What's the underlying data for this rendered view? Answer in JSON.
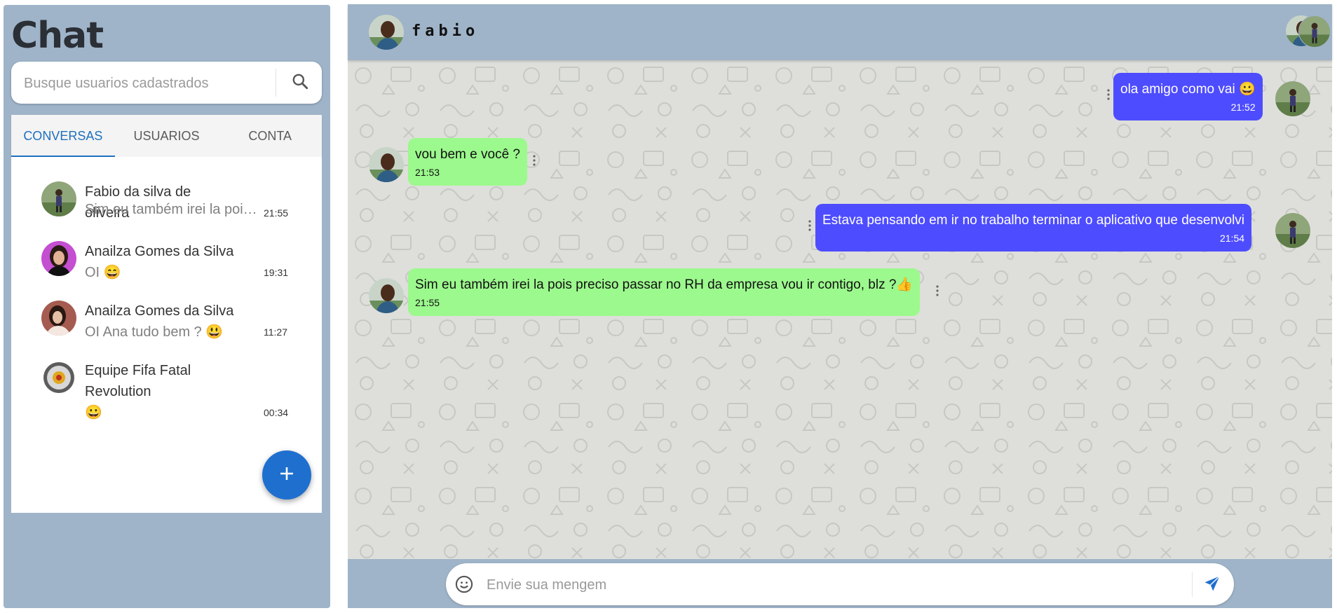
{
  "sidebar": {
    "title": "Chat",
    "search": {
      "placeholder": "Busque usuarios cadastrados",
      "icon": "search-icon"
    },
    "tabs": [
      {
        "label": "CONVERSAS",
        "active": true
      },
      {
        "label": "USUARIOS",
        "active": false
      },
      {
        "label": "CONTA",
        "active": false
      }
    ],
    "conversations": [
      {
        "name": "Fabio da silva de oliveira",
        "preview": "Sim eu também irei la pois preciso passar no RH da empresa vou ir contigo, blz ?👍",
        "time": "21:55",
        "avatar": "fabio-photo"
      },
      {
        "name": "Anailza Gomes da Silva",
        "preview": "OI 😄",
        "time": "19:31",
        "avatar": "anailza-photo-1"
      },
      {
        "name": "Anailza Gomes da Silva",
        "preview": "OI Ana tudo bem ? 😃",
        "time": "11:27",
        "avatar": "anailza-photo-2"
      },
      {
        "name": "Equipe Fifa Fatal Revolution",
        "preview": "😀",
        "time": "00:34",
        "avatar": "fifa-logo"
      }
    ],
    "fab_icon": "plus-icon"
  },
  "chat": {
    "contact_name": "fabio",
    "messages": [
      {
        "direction": "sent",
        "text": "ola amigo como vai 😀",
        "time": "21:52"
      },
      {
        "direction": "received",
        "text": "vou bem e você ?",
        "time": "21:53"
      },
      {
        "direction": "sent",
        "text": "Estava pensando em ir no trabalho terminar o aplicativo que desenvolvi",
        "time": "21:54"
      },
      {
        "direction": "received",
        "text": "Sim eu também irei la pois preciso passar no RH da empresa vou ir contigo, blz ?👍",
        "time": "21:55"
      }
    ],
    "composer": {
      "placeholder": "Envie sua mengem",
      "emoji_icon": "emoji-icon",
      "send_icon": "send-icon"
    }
  },
  "colors": {
    "panel": "#9fb4c9",
    "sent_bubble": "#4e4cff",
    "received_bubble": "#9cf98d",
    "accent": "#1f6fbf"
  }
}
